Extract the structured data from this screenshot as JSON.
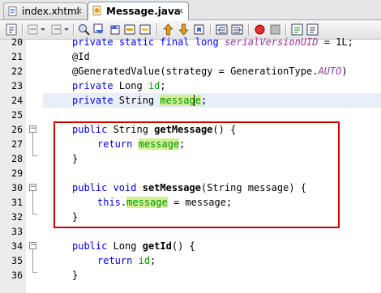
{
  "tabs": [
    {
      "label": "index.xhtml",
      "close": "×",
      "active": false
    },
    {
      "label": "Message.java",
      "close": "×",
      "active": true
    }
  ],
  "toolbar": {
    "icons": [
      "history-icon",
      "back-icon",
      "dropdown-icon",
      "forward-icon",
      "dropdown-icon",
      "find-icon",
      "find-previous-icon",
      "find-next-icon",
      "toggle-highlight-icon",
      "previous-bookmark-icon",
      "next-bookmark-icon",
      "toggle-bookmark-icon",
      "shift-left-icon",
      "shift-right-icon",
      "start-macro-icon",
      "stop-macro-icon",
      "comment-icon",
      "uncomment-icon"
    ]
  },
  "editor": {
    "lines": [
      {
        "num": "20",
        "text": "private static final long serialVersionUID = 1L;"
      },
      {
        "num": "21",
        "text": "@Id"
      },
      {
        "num": "22",
        "text": "@GeneratedValue(strategy = GenerationType.AUTO)"
      },
      {
        "num": "23",
        "text": "private Long id;"
      },
      {
        "num": "24",
        "text": "private String message;"
      },
      {
        "num": "25",
        "text": ""
      },
      {
        "num": "26",
        "text": "public String getMessage() {"
      },
      {
        "num": "27",
        "text": "return message;"
      },
      {
        "num": "28",
        "text": "}"
      },
      {
        "num": "29",
        "text": ""
      },
      {
        "num": "30",
        "text": "public void setMessage(String message) {"
      },
      {
        "num": "31",
        "text": "this.message = message;"
      },
      {
        "num": "32",
        "text": "}"
      },
      {
        "num": "33",
        "text": ""
      },
      {
        "num": "34",
        "text": "public Long getId() {"
      },
      {
        "num": "35",
        "text": "return id;"
      },
      {
        "num": "36",
        "text": "}"
      }
    ],
    "tokens": {
      "private": "private",
      "static": "static",
      "final": "final",
      "long": "long",
      "serialVersionUID": "serialVersionUID",
      "eq1L": " = 1L;",
      "id_ann": "@Id",
      "gen_ann": "@GeneratedValue(strategy = GenerationType.",
      "auto": "AUTO",
      "close_paren": ")",
      "Long": " Long ",
      "id": "id",
      "semi": ";",
      "String": " String ",
      "message_a": "mess",
      "message_b": "age",
      "public": "public",
      "getMessage": "getMessage",
      "params_empty": "() {",
      "return": "return",
      "message": "message",
      "rbrace": "}",
      "void": " void ",
      "setMessage": "setMessage",
      "params_set": "(String message) {",
      "this": "this",
      "dot": ".",
      "assign": " = message;",
      "getId": "getId"
    }
  },
  "colors": {
    "keyword": "#0000e6",
    "field": "#009900",
    "highlight": "#d3ee96",
    "annotation_box": "#d40000",
    "current_line": "#e9eff8"
  }
}
